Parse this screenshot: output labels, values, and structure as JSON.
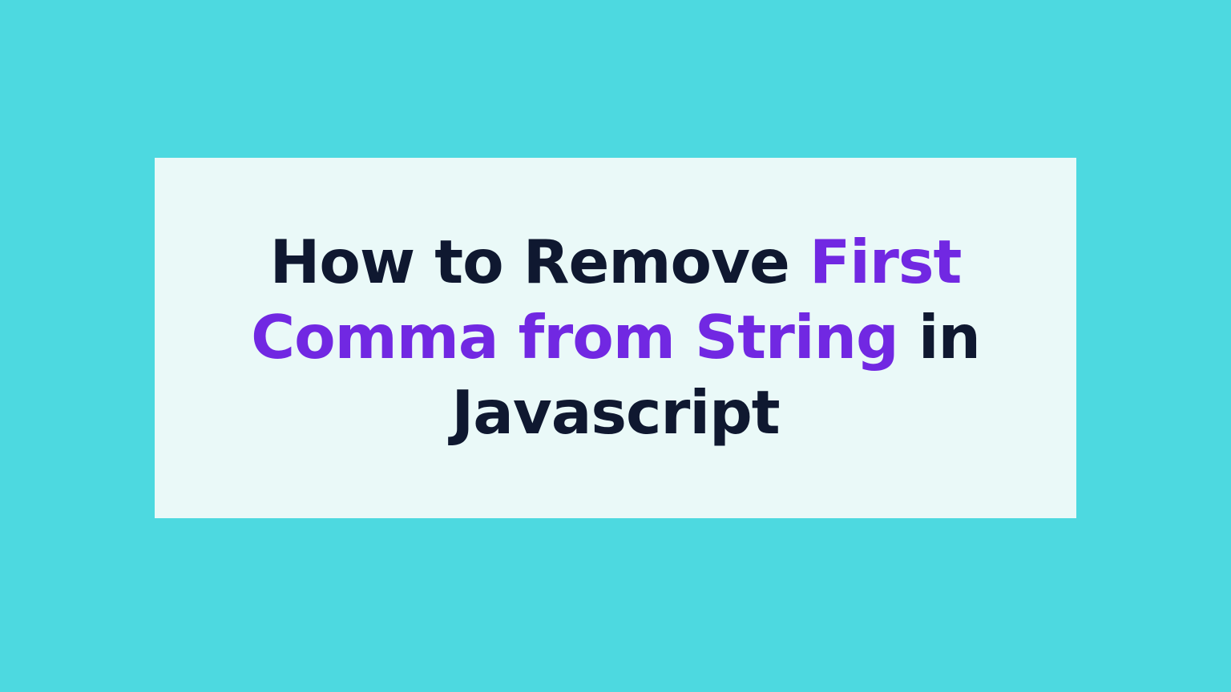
{
  "heading": {
    "part1": "How to Remove ",
    "part2": "First Comma from String",
    "part3": " in Javascript"
  },
  "colors": {
    "background": "#4dd9e0",
    "card": "#eaf9f8",
    "text_primary": "#0f1830",
    "text_highlight": "#7128e2"
  }
}
